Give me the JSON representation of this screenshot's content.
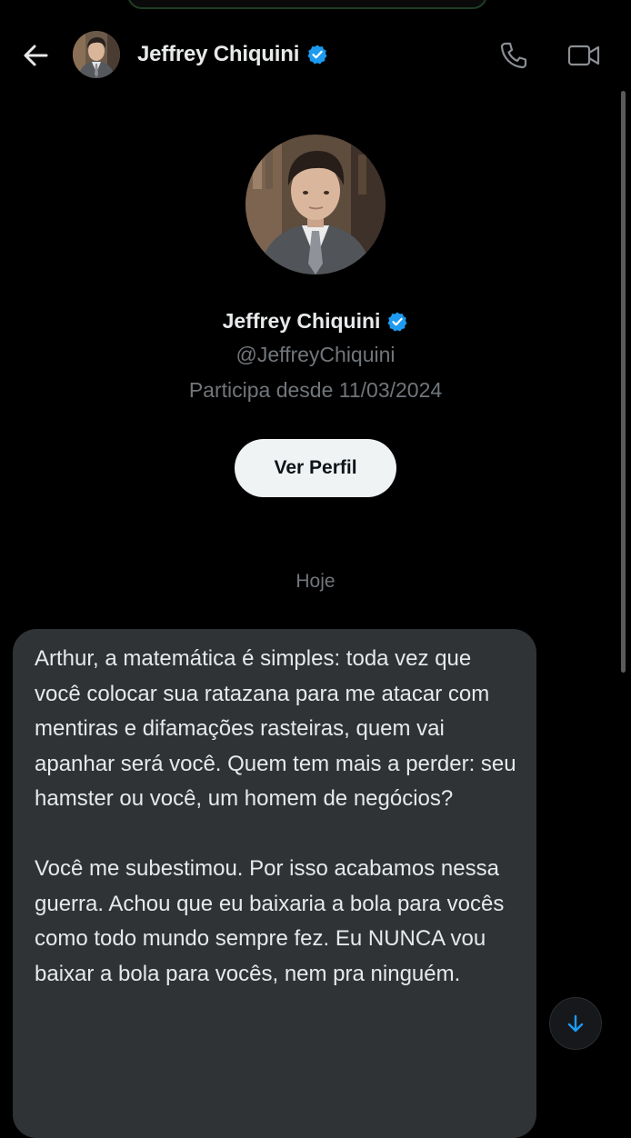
{
  "header": {
    "back_icon": "arrow-left-icon",
    "name": "Jeffrey Chiquini",
    "verified_icon": "verified-badge-icon",
    "call_icon": "phone-icon",
    "video_icon": "video-camera-icon"
  },
  "profile": {
    "name": "Jeffrey Chiquini",
    "handle": "@JeffreyChiquini",
    "joined": "Participa desde 11/03/2024",
    "view_profile_label": "Ver Perfil"
  },
  "conversation": {
    "date_label": "Hoje",
    "messages": [
      {
        "paragraphs": [
          "Arthur, a matemática é simples: toda vez que você colocar sua ratazana para me atacar com mentiras e difamações rasteiras, quem vai apanhar será você. Quem tem mais a perder: seu hamster ou você, um homem de negócios?",
          "Você me subestimou. Por isso acabamos nessa guerra. Achou que eu baixaria a bola para vocês como todo mundo sempre fez. Eu NUNCA vou baixar a bola para vocês, nem pra ninguém."
        ]
      }
    ]
  },
  "scroll_down_icon": "arrow-down-icon",
  "colors": {
    "background": "#000000",
    "text_primary": "#e7e9ea",
    "text_secondary": "#71767b",
    "bubble": "#2f3336",
    "accent": "#1d9bf0",
    "button_bg": "#eff3f4"
  }
}
